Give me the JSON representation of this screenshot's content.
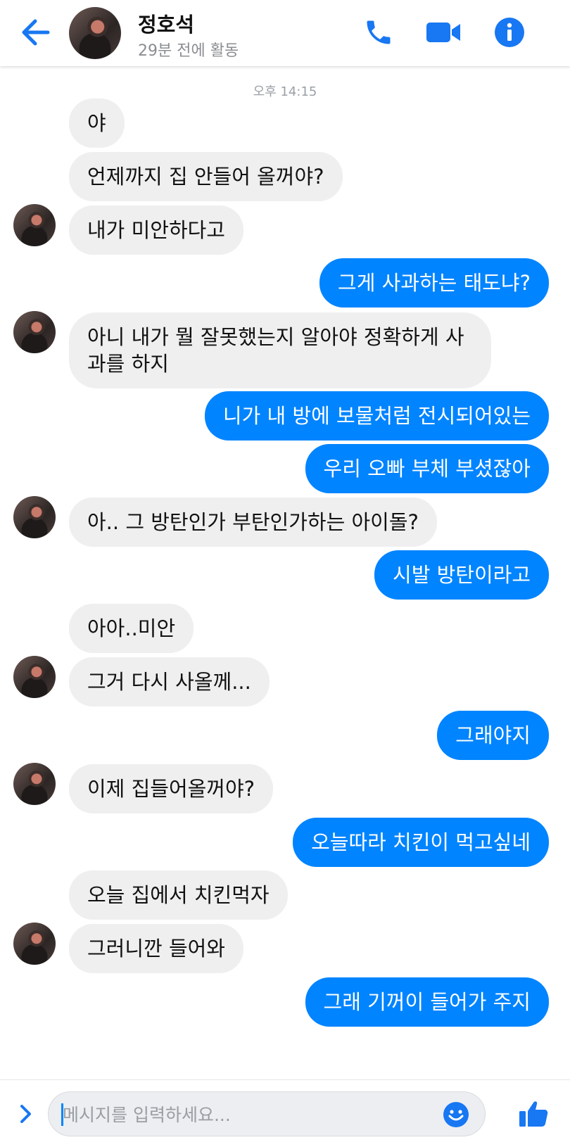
{
  "header": {
    "contact_name": "정호석",
    "status": "29분 전에 활동",
    "colors": {
      "accent": "#0084ff",
      "icon_blue": "#1877f2"
    },
    "icons": [
      "back-arrow-icon",
      "phone-icon",
      "video-camera-icon",
      "info-icon"
    ]
  },
  "conversation": {
    "timestamp": "오후 14:15",
    "messages": [
      {
        "from": "them",
        "text": "야"
      },
      {
        "from": "them",
        "text": "언제까지 집 안들어 올꺼야?"
      },
      {
        "from": "them",
        "text": "내가 미안하다고"
      },
      {
        "from": "me",
        "text": "그게 사과하는 태도냐?"
      },
      {
        "from": "them",
        "text": "아니 내가 뭘 잘못했는지 알아야 정확하게 사과를 하지"
      },
      {
        "from": "me",
        "text": "니가 내 방에 보물처럼 전시되어있는"
      },
      {
        "from": "me",
        "text": "우리 오빠 부체 부셨잖아"
      },
      {
        "from": "them",
        "text": "아.. 그 방탄인가 부탄인가하는 아이돌?"
      },
      {
        "from": "me",
        "text": "시발 방탄이라고"
      },
      {
        "from": "them",
        "text": "아아..미안"
      },
      {
        "from": "them",
        "text": "그거 다시 사올께..."
      },
      {
        "from": "me",
        "text": "그래야지"
      },
      {
        "from": "them",
        "text": "이제 집들어올꺼야?"
      },
      {
        "from": "me",
        "text": "오늘따라 치킨이 먹고싶네"
      },
      {
        "from": "them",
        "text": "오늘 집에서 치킨먹자"
      },
      {
        "from": "them",
        "text": "그러니깐 들어와"
      },
      {
        "from": "me",
        "text": "그래 기꺼이 들어가 주지"
      }
    ],
    "colors": {
      "incoming_bubble": "#efefef",
      "outgoing_bubble": "#0084ff"
    }
  },
  "composer": {
    "placeholder": "메시지를 입력하세요...",
    "value": "",
    "icons": [
      "chevron-right-icon",
      "emoji-icon",
      "thumbs-up-icon"
    ]
  }
}
